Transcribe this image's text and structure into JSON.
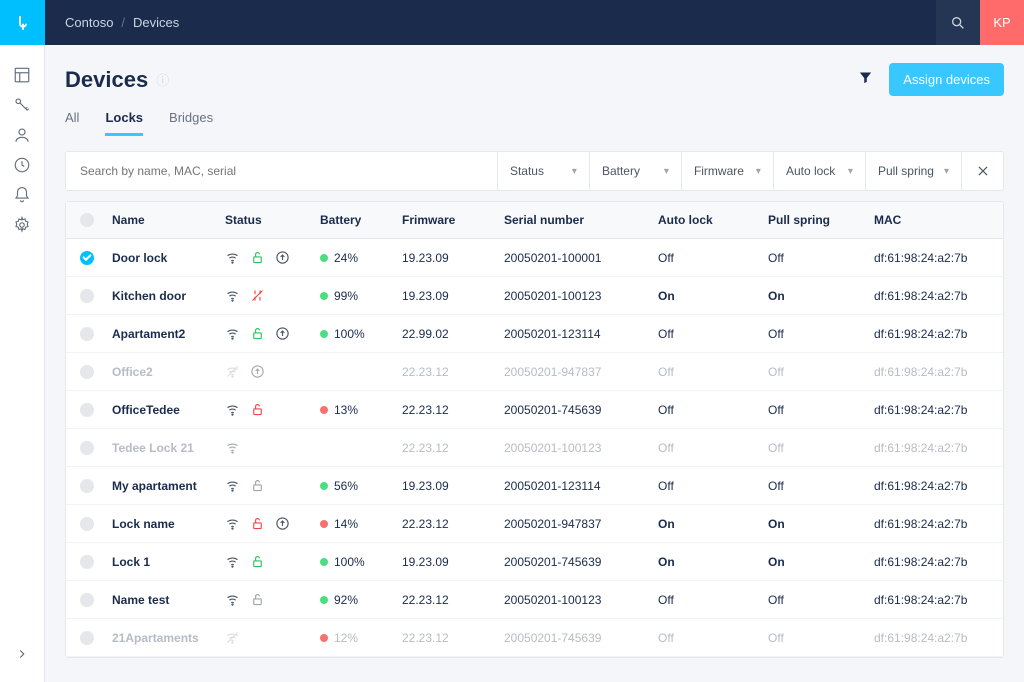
{
  "breadcrumb": {
    "org": "Contoso",
    "section": "Devices"
  },
  "user": {
    "initials": "KP"
  },
  "page": {
    "title": "Devices",
    "assign_button": "Assign devices"
  },
  "tabs": [
    {
      "label": "All",
      "active": false
    },
    {
      "label": "Locks",
      "active": true
    },
    {
      "label": "Bridges",
      "active": false
    }
  ],
  "search": {
    "placeholder": "Search by name, MAC, serial"
  },
  "filters": [
    {
      "label": "Status"
    },
    {
      "label": "Battery"
    },
    {
      "label": "Firmware"
    },
    {
      "label": "Auto lock"
    },
    {
      "label": "Pull spring"
    }
  ],
  "columns": {
    "name": "Name",
    "status": "Status",
    "battery": "Battery",
    "firmware": "Frimware",
    "serial": "Serial number",
    "autolock": "Auto lock",
    "pullspring": "Pull spring",
    "mac": "MAC"
  },
  "rows": [
    {
      "checked": true,
      "muted": false,
      "name": "Door lock",
      "wifi": true,
      "lock": "green",
      "update": true,
      "battery_dot": "green",
      "battery": "24%",
      "firmware": "19.23.09",
      "serial": "20050201-100001",
      "autolock": "Off",
      "pullspring": "Off",
      "mac": "df:61:98:24:a2:7b"
    },
    {
      "checked": false,
      "muted": false,
      "name": "Kitchen door",
      "wifi": true,
      "lock": "offline",
      "update": false,
      "battery_dot": "green",
      "battery": "99%",
      "firmware": "19.23.09",
      "serial": "20050201-100123",
      "autolock": "On",
      "pullspring": "On",
      "mac": "df:61:98:24:a2:7b"
    },
    {
      "checked": false,
      "muted": false,
      "name": "Apartament2",
      "wifi": true,
      "lock": "green",
      "update": true,
      "battery_dot": "green",
      "battery": "100%",
      "firmware": "22.99.02",
      "serial": "20050201-123114",
      "autolock": "Off",
      "pullspring": "Off",
      "mac": "df:61:98:24:a2:7b"
    },
    {
      "checked": false,
      "muted": true,
      "name": "Office2",
      "wifi": "off",
      "lock": "none",
      "update": true,
      "battery_dot": "",
      "battery": "",
      "firmware": "22.23.12",
      "serial": "20050201-947837",
      "autolock": "Off",
      "pullspring": "Off",
      "mac": "df:61:98:24:a2:7b"
    },
    {
      "checked": false,
      "muted": false,
      "name": "OfficeTedee",
      "wifi": true,
      "lock": "red",
      "update": false,
      "battery_dot": "red",
      "battery": "13%",
      "firmware": "22.23.12",
      "serial": "20050201-745639",
      "autolock": "Off",
      "pullspring": "Off",
      "mac": "df:61:98:24:a2:7b"
    },
    {
      "checked": false,
      "muted": true,
      "name": "Tedee Lock 21",
      "wifi": true,
      "lock": "none",
      "update": false,
      "battery_dot": "",
      "battery": "",
      "firmware": "22.23.12",
      "serial": "20050201-100123",
      "autolock": "Off",
      "pullspring": "Off",
      "mac": "df:61:98:24:a2:7b"
    },
    {
      "checked": false,
      "muted": false,
      "name": "My apartament",
      "wifi": true,
      "lock": "gray",
      "update": false,
      "battery_dot": "green",
      "battery": "56%",
      "firmware": "19.23.09",
      "serial": "20050201-123114",
      "autolock": "Off",
      "pullspring": "Off",
      "mac": "df:61:98:24:a2:7b"
    },
    {
      "checked": false,
      "muted": false,
      "name": "Lock name",
      "wifi": true,
      "lock": "red",
      "update": true,
      "battery_dot": "red",
      "battery": "14%",
      "firmware": "22.23.12",
      "serial": "20050201-947837",
      "autolock": "On",
      "pullspring": "On",
      "mac": "df:61:98:24:a2:7b"
    },
    {
      "checked": false,
      "muted": false,
      "name": "Lock 1",
      "wifi": true,
      "lock": "green",
      "update": false,
      "battery_dot": "green",
      "battery": "100%",
      "firmware": "19.23.09",
      "serial": "20050201-745639",
      "autolock": "On",
      "pullspring": "On",
      "mac": "df:61:98:24:a2:7b"
    },
    {
      "checked": false,
      "muted": false,
      "name": "Name test",
      "wifi": true,
      "lock": "gray",
      "update": false,
      "battery_dot": "green",
      "battery": "92%",
      "firmware": "22.23.12",
      "serial": "20050201-100123",
      "autolock": "Off",
      "pullspring": "Off",
      "mac": "df:61:98:24:a2:7b"
    },
    {
      "checked": false,
      "muted": true,
      "name": "21Apartaments",
      "wifi": "off",
      "lock": "none",
      "update": false,
      "battery_dot": "red",
      "battery": "12%",
      "firmware": "22.23.12",
      "serial": "20050201-745639",
      "autolock": "Off",
      "pullspring": "Off",
      "mac": "df:61:98:24:a2:7b"
    }
  ],
  "icons": {
    "wifi": "wifi-icon",
    "lock_open": "lock-open-icon",
    "update": "update-icon",
    "lock_closed": "lock-closed-icon",
    "offline": "offline-icon"
  }
}
